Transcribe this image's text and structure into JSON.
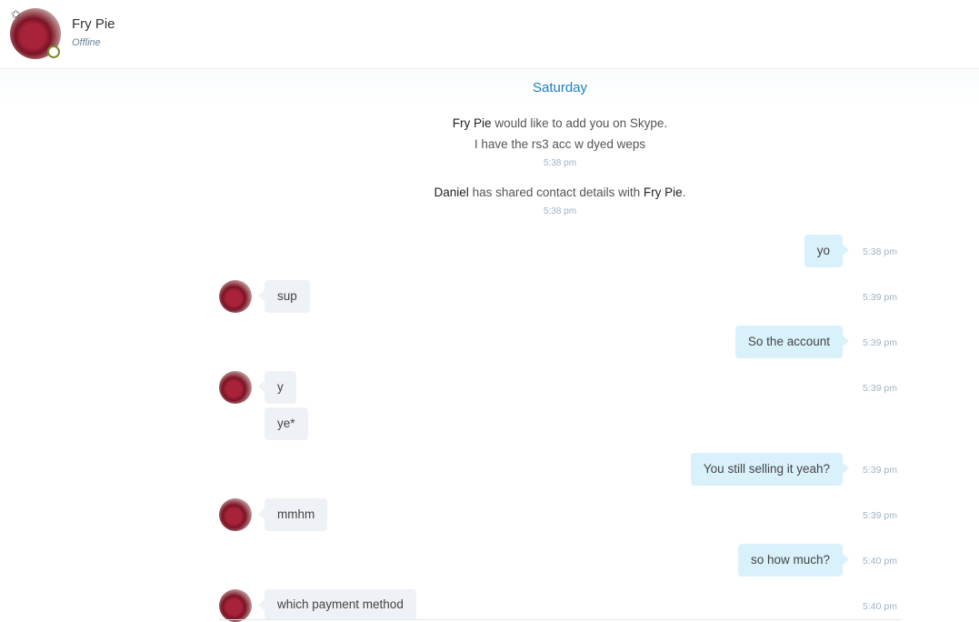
{
  "header": {
    "contact_name": "Fry Pie",
    "status": "Offline",
    "favorite_icon": "star-outline-icon",
    "presence_color": "#7a8b2f"
  },
  "conversation": {
    "day": "Saturday",
    "system_messages": [
      {
        "name_a": "Fry Pie",
        "text_a": " would like to add you on Skype.",
        "line2": "I have the rs3 acc w dyed weps",
        "time": "5:38 pm"
      },
      {
        "name_a": "Daniel",
        "text_a": " has shared contact details with ",
        "name_b": "Fry Pie",
        "end": ".",
        "time": "5:38 pm"
      }
    ],
    "messages": [
      {
        "dir": "out",
        "text": "yo",
        "time": "5:38 pm"
      },
      {
        "dir": "in",
        "text": "sup",
        "time": "5:39 pm"
      },
      {
        "dir": "out",
        "text": "So the account",
        "time": "5:39 pm"
      },
      {
        "dir": "in",
        "text": "y",
        "time": "5:39 pm"
      },
      {
        "dir": "in",
        "text": "ye*"
      },
      {
        "dir": "out",
        "text": "You still selling it yeah?",
        "time": "5:39 pm"
      },
      {
        "dir": "in",
        "text": "mmhm",
        "time": "5:39 pm"
      },
      {
        "dir": "out",
        "text": "so how much?",
        "time": "5:40 pm"
      },
      {
        "dir": "in",
        "text": "which payment method",
        "time": "5:40 pm"
      }
    ]
  },
  "colors": {
    "accent": "#1d7fbf",
    "outgoing_bubble": "#d9f1fb",
    "incoming_bubble": "#eef1f5"
  }
}
